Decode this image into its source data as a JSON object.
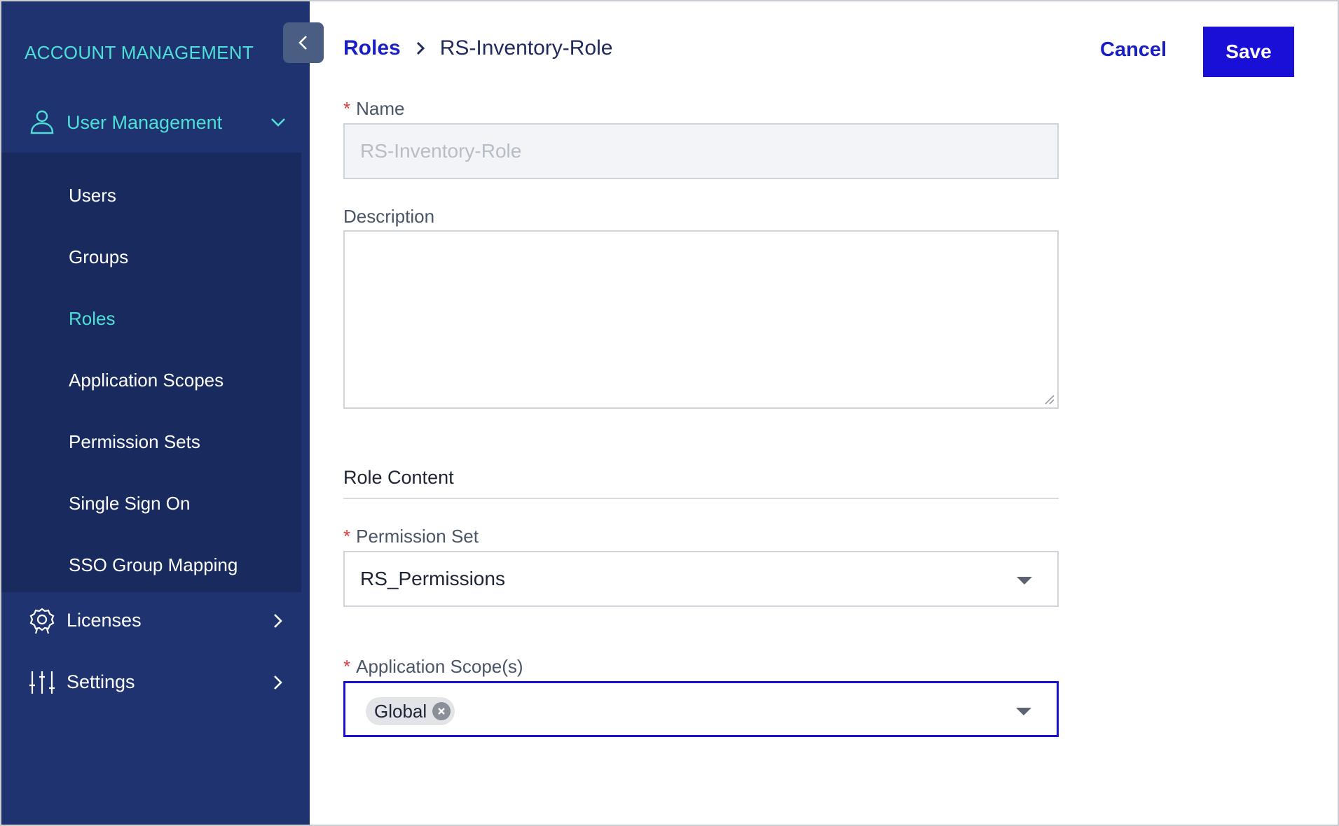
{
  "sidebar": {
    "brand": "ACCOUNT MANAGEMENT",
    "group": {
      "label": "User Management",
      "icon": "user-icon",
      "expanded": true
    },
    "sub_items": [
      {
        "label": "Users",
        "active": false
      },
      {
        "label": "Groups",
        "active": false
      },
      {
        "label": "Roles",
        "active": true
      },
      {
        "label": "Application Scopes",
        "active": false
      },
      {
        "label": "Permission Sets",
        "active": false
      },
      {
        "label": "Single Sign On",
        "active": false
      },
      {
        "label": "SSO Group Mapping",
        "active": false
      }
    ],
    "items": [
      {
        "label": "Licenses",
        "icon": "badge-icon"
      },
      {
        "label": "Settings",
        "icon": "sliders-icon"
      }
    ]
  },
  "header": {
    "breadcrumb_parent": "Roles",
    "breadcrumb_current": "RS-Inventory-Role",
    "cancel_label": "Cancel",
    "save_label": "Save"
  },
  "form": {
    "name_label": "Name",
    "name_value": "RS-Inventory-Role",
    "description_label": "Description",
    "description_value": "",
    "section_title": "Role Content",
    "permission_set_label": "Permission Set",
    "permission_set_value": "RS_Permissions",
    "app_scope_label": "Application Scope(s)",
    "app_scope_tags": [
      "Global"
    ],
    "required_mark": "*"
  },
  "colors": {
    "sidebar_bg": "#1f3371",
    "submenu_bg": "#182a5e",
    "accent_teal": "#4ee0d6",
    "primary_blue": "#1a0fd6",
    "link_blue": "#1a1fc4",
    "required_red": "#e03a3a"
  }
}
